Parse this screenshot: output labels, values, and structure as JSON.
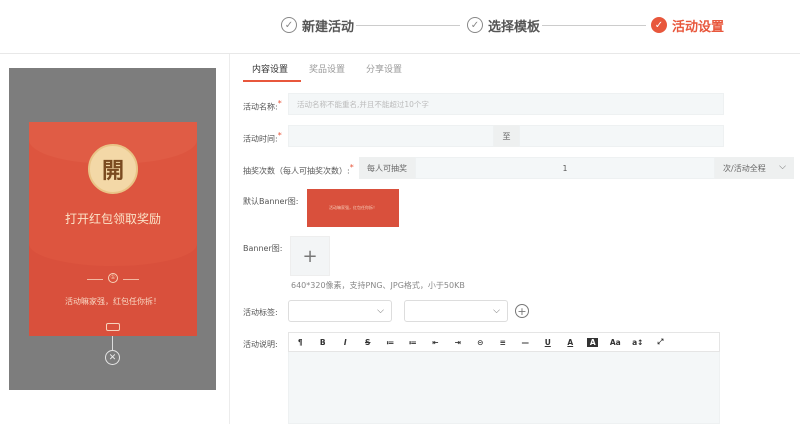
{
  "steps": [
    {
      "label": "新建活动",
      "state": "done",
      "icon": "check-circle-icon"
    },
    {
      "label": "选择模板",
      "state": "done",
      "icon": "check-circle-icon"
    },
    {
      "label": "活动设置",
      "state": "active",
      "icon": "check-circle-filled-icon"
    }
  ],
  "preview": {
    "open_char": "開",
    "title": "打开红包领取奖励",
    "badge": "①",
    "wish": "活动嘛家强，红包任你拆！"
  },
  "tabs": [
    "内容设置",
    "奖品设置",
    "分享设置"
  ],
  "form": {
    "name_label": "活动名称:",
    "name_placeholder": "活动名称不能重名,并且不能超过10个字",
    "time_label": "活动时间:",
    "time_sep": "至",
    "draw_label": "抽奖次数（每人可抽奖次数）:",
    "draw_prefix": "每人可抽奖",
    "draw_value": "1",
    "draw_unit": "次/活动全程",
    "banner_default_label": "默认Banner图:",
    "banner_thumb_text": "活动嘛家强，红包任你拆！",
    "banner_label": "Banner图:",
    "upload_symbol": "+",
    "banner_hint": "640*320像素，支持PNG、JPG格式，小于50KB",
    "tag_label": "活动标签:",
    "desc_label": "活动说明:"
  },
  "editor_toolbar": [
    "¶",
    "B",
    "I",
    "S",
    "≔",
    "≔",
    "⇤",
    "⇥",
    "⊝",
    "≡",
    "—",
    "U",
    "A",
    "A",
    "Aa",
    "a↕",
    "⤢"
  ],
  "colors": {
    "accent": "#e8573c",
    "envelope": "#d9503c",
    "preview_bg": "#7d7d7d"
  }
}
